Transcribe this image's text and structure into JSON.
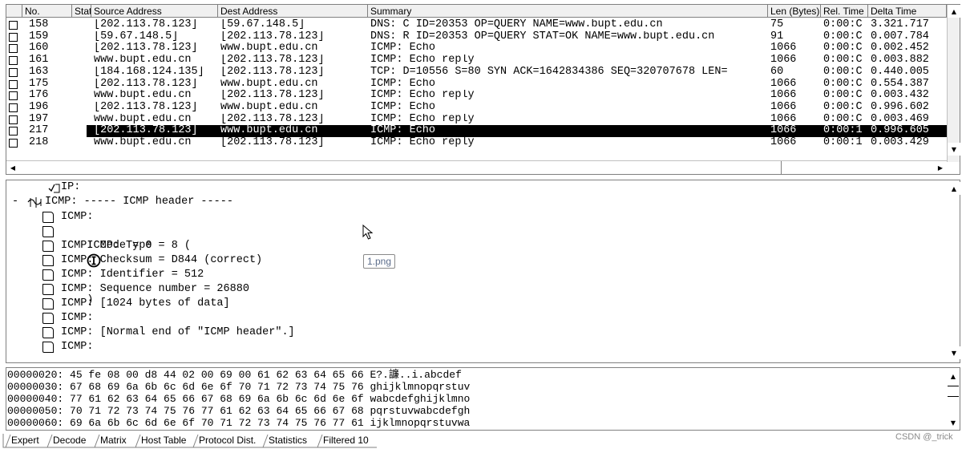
{
  "packet_list": {
    "columns": [
      "No.",
      "Statu",
      "Source Address",
      "Dest Address",
      "Summary",
      "Len (Bytes)",
      "Rel. Time",
      "Delta Time"
    ],
    "rows": [
      {
        "no": "158",
        "src": "[202.113.78.123]",
        "dst": "[59.67.148.5]",
        "summary": "DNS: C ID=20353 OP=QUERY NAME=www.bupt.edu.cn",
        "len": "75",
        "rel": "0:00:C",
        "delta": "3.321.717"
      },
      {
        "no": "159",
        "src": "[59.67.148.5]",
        "dst": "[202.113.78.123]",
        "summary": "DNS: R ID=20353 OP=QUERY STAT=OK NAME=www.bupt.edu.cn",
        "len": "91",
        "rel": "0:00:C",
        "delta": "0.007.784"
      },
      {
        "no": "160",
        "src": "[202.113.78.123]",
        "dst": "www.bupt.edu.cn",
        "summary": "ICMP: Echo",
        "len": "1066",
        "rel": "0:00:C",
        "delta": "0.002.452"
      },
      {
        "no": "161",
        "src": "www.bupt.edu.cn",
        "dst": "[202.113.78.123]",
        "summary": "ICMP: Echo reply",
        "len": "1066",
        "rel": "0:00:C",
        "delta": "0.003.882"
      },
      {
        "no": "163",
        "src": "[184.168.124.135]",
        "dst": "[202.113.78.123]",
        "summary": "TCP: D=10556 S=80 SYN ACK=1642834386 SEQ=320707678 LEN=",
        "len": "60",
        "rel": "0:00:C",
        "delta": "0.440.005"
      },
      {
        "no": "175",
        "src": "[202.113.78.123]",
        "dst": "www.bupt.edu.cn",
        "summary": "ICMP: Echo",
        "len": "1066",
        "rel": "0:00:C",
        "delta": "0.554.387"
      },
      {
        "no": "176",
        "src": "www.bupt.edu.cn",
        "dst": "[202.113.78.123]",
        "summary": "ICMP: Echo reply",
        "len": "1066",
        "rel": "0:00:C",
        "delta": "0.003.432"
      },
      {
        "no": "196",
        "src": "[202.113.78.123]",
        "dst": "www.bupt.edu.cn",
        "summary": "ICMP: Echo",
        "len": "1066",
        "rel": "0:00:C",
        "delta": "0.996.602"
      },
      {
        "no": "197",
        "src": "www.bupt.edu.cn",
        "dst": "[202.113.78.123]",
        "summary": "ICMP: Echo reply",
        "len": "1066",
        "rel": "0:00:C",
        "delta": "0.003.469"
      },
      {
        "no": "217",
        "src": "[202.113.78.123]",
        "dst": "www.bupt.edu.cn",
        "summary": "ICMP: Echo",
        "len": "1066",
        "rel": "0:00:1",
        "delta": "0.996.605",
        "selected": true
      },
      {
        "no": "218",
        "src": "www.bupt.edu.cn",
        "dst": "[202.113.78.123]",
        "summary": "ICMP: Echo reply",
        "len": "1066",
        "rel": "0:00:1",
        "delta": "0.003.429"
      }
    ]
  },
  "decode": {
    "ip_line": "IP:",
    "icmp_header": "ICMP: ----- ICMP header -----",
    "expand_marker": "-",
    "type_prefix": "ICMP: Type = 8 (",
    "type_suffix": ")",
    "lines": [
      "ICMP:",
      "ICMP: Code = 0",
      "ICMP: Checksum = D844 (correct)",
      "ICMP: Identifier = 512",
      "ICMP: Sequence number = 26880",
      "ICMP: [1024 bytes of data]",
      "ICMP:",
      "ICMP: [Normal end of \"ICMP header\".]",
      "ICMP:"
    ],
    "tooltip": "1.png"
  },
  "hex": {
    "lines": [
      "00000020: 45 fe 08 00 d8 44 02 00 69 00 61 62 63 64 65 66 E?.譧..i.abcdef",
      "00000030: 67 68 69 6a 6b 6c 6d 6e 6f 70 71 72 73 74 75 76 ghijklmnopqrstuv",
      "00000040: 77 61 62 63 64 65 66 67 68 69 6a 6b 6c 6d 6e 6f wabcdefghijklmno",
      "00000050: 70 71 72 73 74 75 76 77 61 62 63 64 65 66 67 68 pqrstuvwabcdefgh",
      "00000060: 69 6a 6b 6c 6d 6e 6f 70 71 72 73 74 75 76 77 61 ijklmnopqrstuvwa"
    ]
  },
  "tabs": [
    "Expert",
    "Decode",
    "Matrix",
    "Host Table",
    "Protocol Dist.",
    "Statistics",
    "Filtered 10"
  ],
  "watermark": "CSDN @_trick"
}
